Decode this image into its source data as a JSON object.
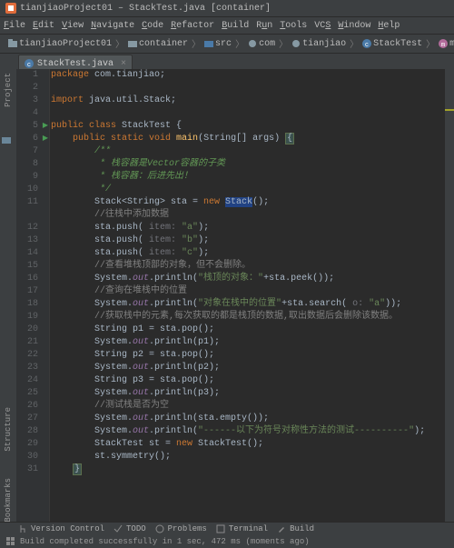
{
  "title": "tianjiaoProject01 – StackTest.java [container]",
  "menu": [
    "File",
    "Edit",
    "View",
    "Navigate",
    "Code",
    "Refactor",
    "Build",
    "Run",
    "Tools",
    "VCS",
    "Window",
    "Help"
  ],
  "menu_u": [
    "F",
    "E",
    "V",
    "N",
    "C",
    "R",
    "B",
    "u",
    "T",
    "S",
    "W",
    "H"
  ],
  "breadcrumbs": [
    "tianjiaoProject01",
    "container",
    "src",
    "com",
    "tianjiao",
    "StackTest",
    "main"
  ],
  "tab": {
    "label": "StackTest.java"
  },
  "left_tabs": [
    "Project",
    "Structure",
    "Bookmarks"
  ],
  "bottom_tabs": [
    "Version Control",
    "TODO",
    "Problems",
    "Terminal",
    "Build"
  ],
  "status": "Build completed successfully in 1 sec, 472 ms (moments ago)",
  "chart_data": null,
  "code": {
    "l1": "package com.tianjiao;",
    "l3a": "import ",
    "l3b": "java.util.Stack;",
    "l5": "public class StackTest {",
    "l6": "    public static void main(String[] args) {",
    "l7": "        /**",
    "l8": "         * 栈容器是Vector容器的子类",
    "l9": "         * 栈容器：后进先出！",
    "l10": "         */",
    "l11p1": "        Stack<String> sta = ",
    "l11p2": "new ",
    "l11p3": "Stack",
    "l11p4": "();",
    "l11c": "//往栈中添加数据",
    "l12": "        sta.push(",
    "l12h": " item: ",
    "l12s": "\"a\"",
    "l12e": ");",
    "l13": "        sta.push(",
    "l13h": " item: ",
    "l13s": "\"b\"",
    "l13e": ");",
    "l14": "        sta.push(",
    "l14h": " item: ",
    "l14s": "\"c\"",
    "l14e": ");",
    "l15": "        //查看堆栈顶部的对象，但不会删除。",
    "l16": "        System.",
    "l16o": "out",
    "l16p": ".println(",
    "l16s": "\"栈顶的对象：\"",
    "l16e": "+sta.peek());",
    "l17": "        //查询在堆栈中的位置",
    "l18": "        System.",
    "l18o": "out",
    "l18p": ".println(",
    "l18s": "\"对象在栈中的位置\"",
    "l18m": "+sta.search(",
    "l18h": " o: ",
    "l18ss": "\"a\"",
    "l18e": "));",
    "l19": "        //获取栈中的元素,每次获取的都是栈顶的数据,取出数据后会删除该数据。",
    "l20": "        String p1 = sta.pop();",
    "l21": "        System.",
    "l21o": "out",
    "l21e": ".println(p1);",
    "l22": "        String p2 = sta.pop();",
    "l23": "        System.",
    "l23o": "out",
    "l23e": ".println(p2);",
    "l24": "        String p3 = sta.pop();",
    "l25": "        System.",
    "l25o": "out",
    "l25e": ".println(p3);",
    "l26": "        //测试栈是否为空",
    "l27": "        System.",
    "l27o": "out",
    "l27e": ".println(sta.empty());",
    "l28": "        System.",
    "l28o": "out",
    "l28p": ".println(",
    "l28s": "\"------以下为符号对称性方法的测试----------\"",
    "l28e": ");",
    "l29": "        StackTest st = ",
    "l29n": "new ",
    "l29c": "StackTest();",
    "l30": "        st.symmetry();",
    "l31": "    }"
  }
}
